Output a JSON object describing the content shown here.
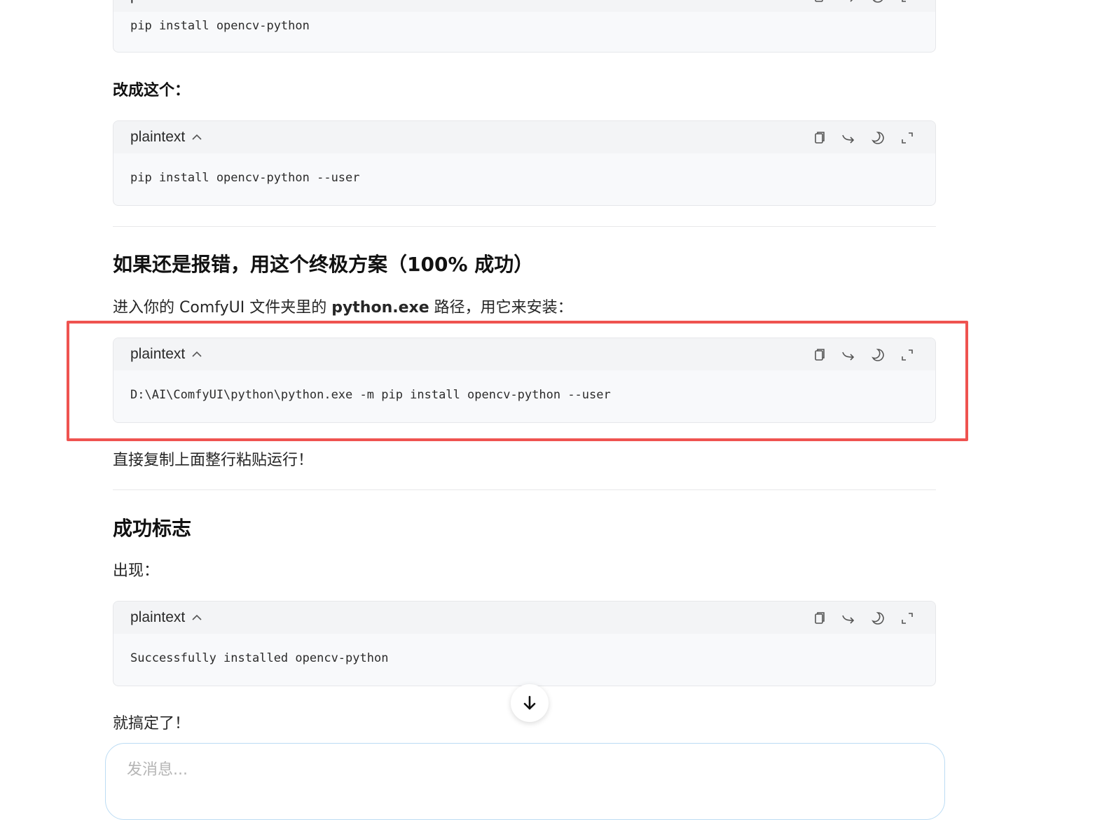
{
  "blocks": [
    {
      "lang": "plaintext",
      "code": "pip install opencv-python"
    },
    {
      "lang": "plaintext",
      "code": "pip install opencv-python --user"
    },
    {
      "lang": "plaintext",
      "code": "D:\\AI\\ComfyUI\\python\\python.exe -m pip install opencv-python --user"
    },
    {
      "lang": "plaintext",
      "code": "Successfully installed opencv-python"
    }
  ],
  "change_to_label": "改成这个：",
  "section1": {
    "heading": "如果还是报错，用这个终极方案（100% 成功）",
    "intro_pre": "进入你的 ComfyUI 文件夹里的 ",
    "intro_bold": "python.exe",
    "intro_post": " 路径，用它来安装：",
    "after": "直接复制上面整行粘贴运行！"
  },
  "section2": {
    "heading": "成功标志",
    "intro": "出现：",
    "after": "就搞定了！"
  },
  "composer": {
    "placeholder": "发消息..."
  },
  "icons": [
    "copy-icon",
    "share-icon",
    "theme-icon",
    "expand-icon",
    "chevron-up-icon",
    "arrow-down-icon"
  ],
  "colors": {
    "highlight": "#ef5350",
    "composer_border": "#bcdcf4"
  }
}
